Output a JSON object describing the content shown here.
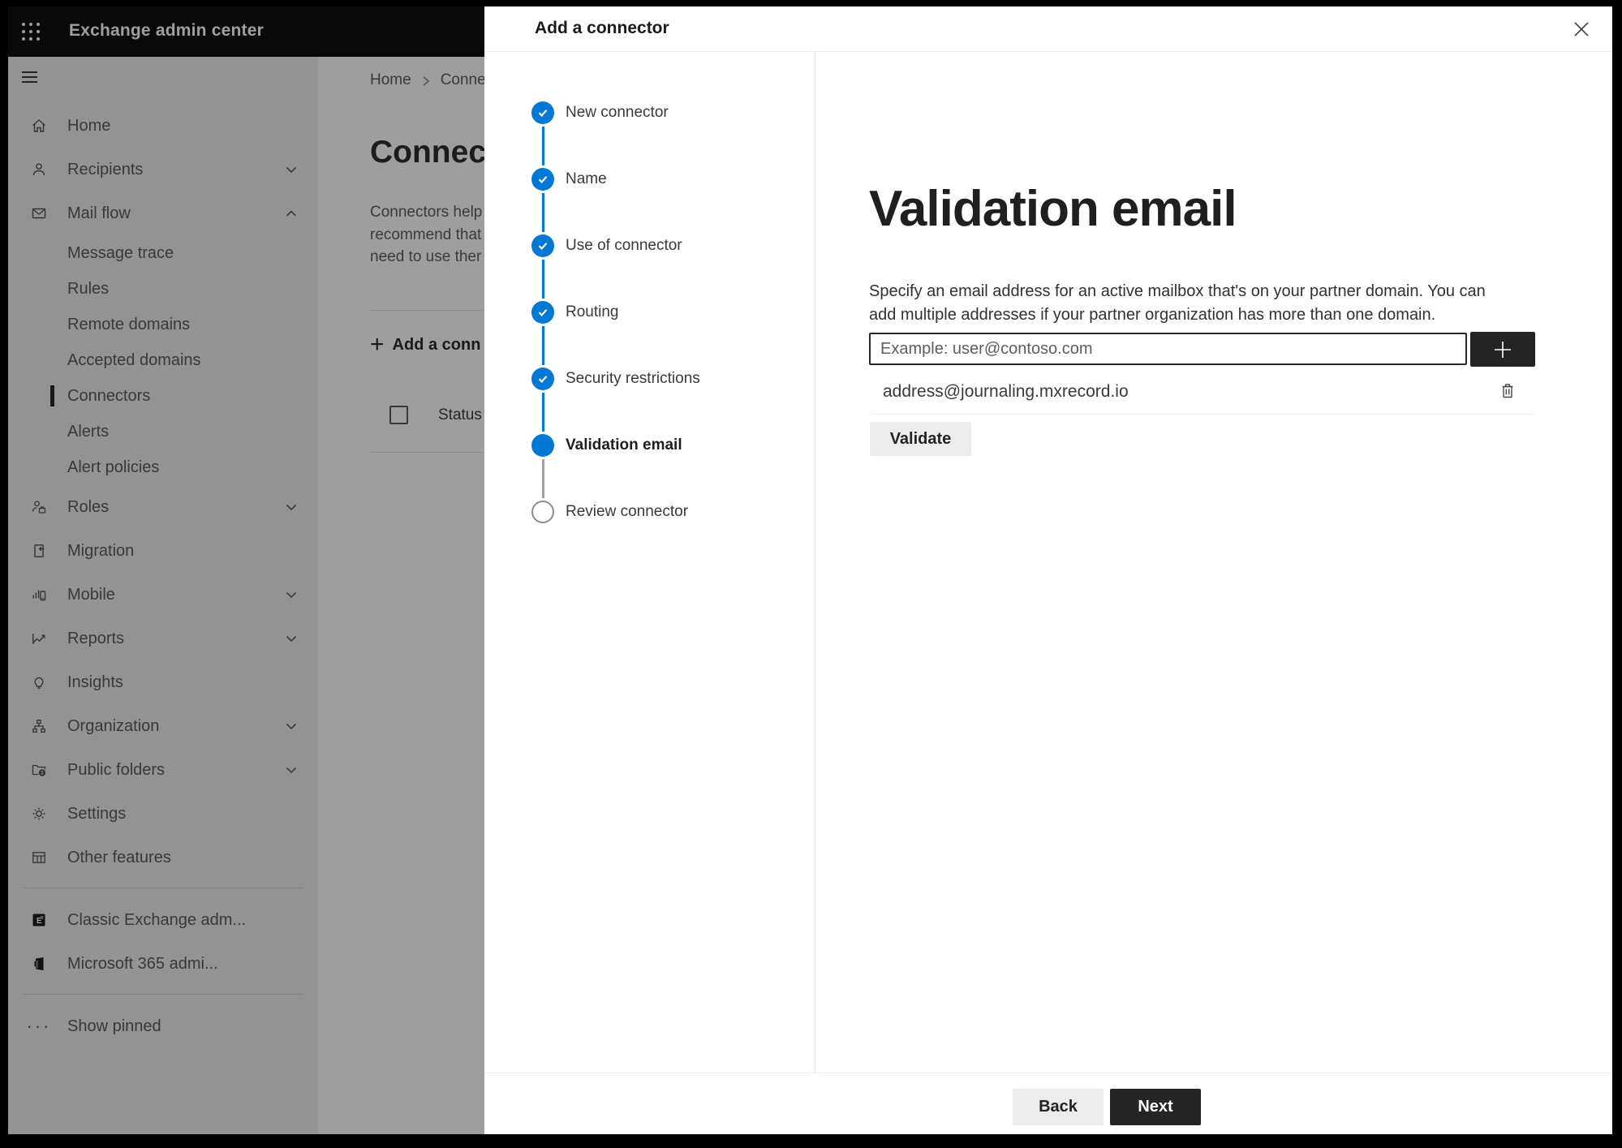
{
  "chrome": {
    "app_title": "Exchange admin center"
  },
  "sidebar": {
    "items": [
      {
        "label": "Home",
        "icon": "home",
        "level": 1
      },
      {
        "label": "Recipients",
        "icon": "person",
        "level": 1,
        "chevron": "down"
      },
      {
        "label": "Mail flow",
        "icon": "mail",
        "level": 1,
        "chevron": "up"
      },
      {
        "label": "Message trace",
        "level": 2
      },
      {
        "label": "Rules",
        "level": 2
      },
      {
        "label": "Remote domains",
        "level": 2
      },
      {
        "label": "Accepted domains",
        "level": 2
      },
      {
        "label": "Connectors",
        "level": 2,
        "selected": true
      },
      {
        "label": "Alerts",
        "level": 2
      },
      {
        "label": "Alert policies",
        "level": 2
      },
      {
        "label": "Roles",
        "icon": "person-badge",
        "level": 1,
        "chevron": "down"
      },
      {
        "label": "Migration",
        "icon": "page-arrow",
        "level": 1
      },
      {
        "label": "Mobile",
        "icon": "mobile-chart",
        "level": 1,
        "chevron": "down"
      },
      {
        "label": "Reports",
        "icon": "line-chart",
        "level": 1,
        "chevron": "down"
      },
      {
        "label": "Insights",
        "icon": "lightbulb",
        "level": 1
      },
      {
        "label": "Organization",
        "icon": "org-tree",
        "level": 1,
        "chevron": "down"
      },
      {
        "label": "Public folders",
        "icon": "folder-globe",
        "level": 1,
        "chevron": "down"
      },
      {
        "label": "Settings",
        "icon": "gear",
        "level": 1
      },
      {
        "label": "Other features",
        "icon": "table-grid",
        "level": 1
      },
      {
        "divider": true
      },
      {
        "label": "Classic Exchange adm...",
        "icon": "exchange-logo",
        "level": 1
      },
      {
        "label": "Microsoft 365 admi...",
        "icon": "office-logo",
        "level": 1
      },
      {
        "divider": true
      },
      {
        "label": "Show pinned",
        "icon": "ellipsis",
        "level": 1
      }
    ]
  },
  "page": {
    "breadcrumb": {
      "home": "Home",
      "current": "Conne"
    },
    "heading": "Connec",
    "description_lines": [
      "Connectors help",
      "recommend that",
      "need to use ther"
    ],
    "add_button_label": "Add a conn",
    "table_header": "Status"
  },
  "wizard": {
    "title": "Add a connector",
    "steps": [
      {
        "label": "New connector",
        "state": "completed"
      },
      {
        "label": "Name",
        "state": "completed"
      },
      {
        "label": "Use of connector",
        "state": "completed"
      },
      {
        "label": "Routing",
        "state": "completed"
      },
      {
        "label": "Security restrictions",
        "state": "completed"
      },
      {
        "label": "Validation email",
        "state": "current"
      },
      {
        "label": "Review connector",
        "state": "upcoming"
      }
    ],
    "content": {
      "heading": "Validation email",
      "description": "Specify an email address for an active mailbox that's on your partner domain. You can add multiple addresses if your partner organization has more than one domain.",
      "email_placeholder": "Example: user@contoso.com",
      "addresses": [
        "address@journaling.mxrecord.io"
      ],
      "validate_label": "Validate"
    },
    "footer": {
      "back_label": "Back",
      "next_label": "Next"
    }
  },
  "colors": {
    "accent": "#0078d4",
    "dark_button": "#242424",
    "step_upcoming_border": "#8f8d8b"
  }
}
